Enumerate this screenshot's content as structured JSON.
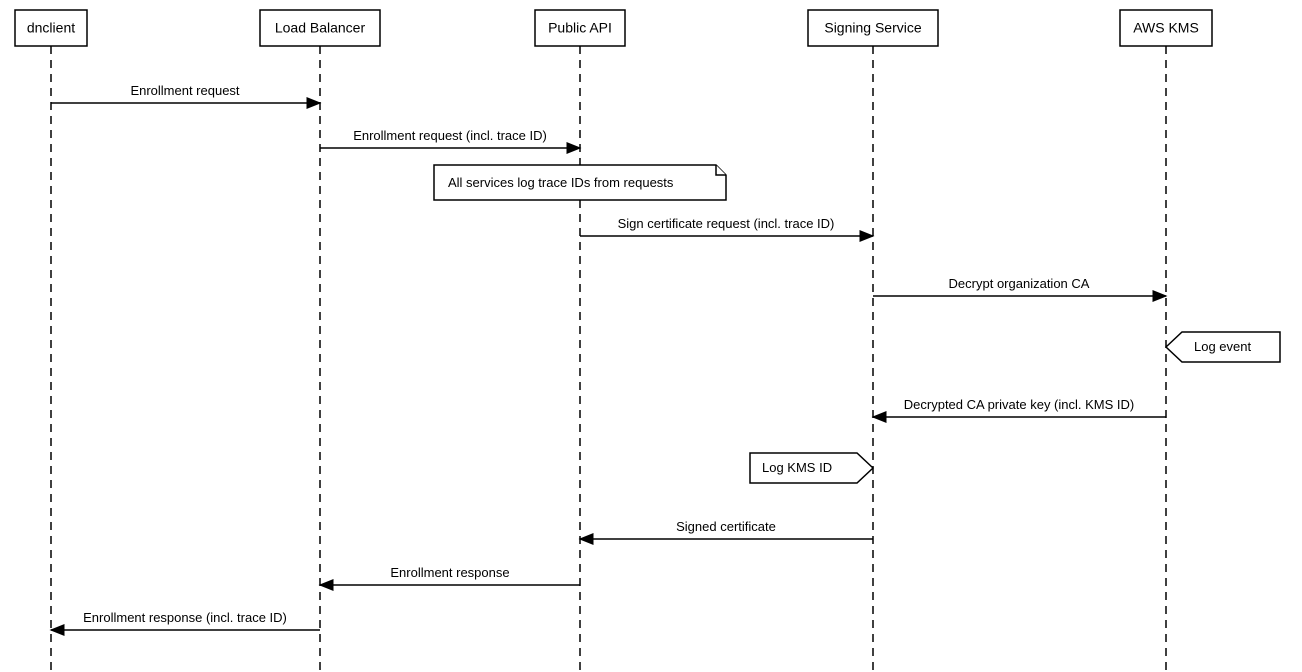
{
  "participants": {
    "p0": "dnclient",
    "p1": "Load Balancer",
    "p2": "Public API",
    "p3": "Signing Service",
    "p4": "AWS KMS"
  },
  "messages": {
    "m1": "Enrollment request",
    "m2": "Enrollment request (incl. trace ID)",
    "m3": "Sign certificate request (incl. trace ID)",
    "m4": "Decrypt organization CA",
    "m5": "Decrypted CA private key (incl. KMS ID)",
    "m6": "Signed certificate",
    "m7": "Enrollment response",
    "m8": "Enrollment response (incl. trace ID)"
  },
  "notes": {
    "n1": "All services log trace IDs from requests",
    "n2": "Log event",
    "n3": "Log KMS ID"
  }
}
